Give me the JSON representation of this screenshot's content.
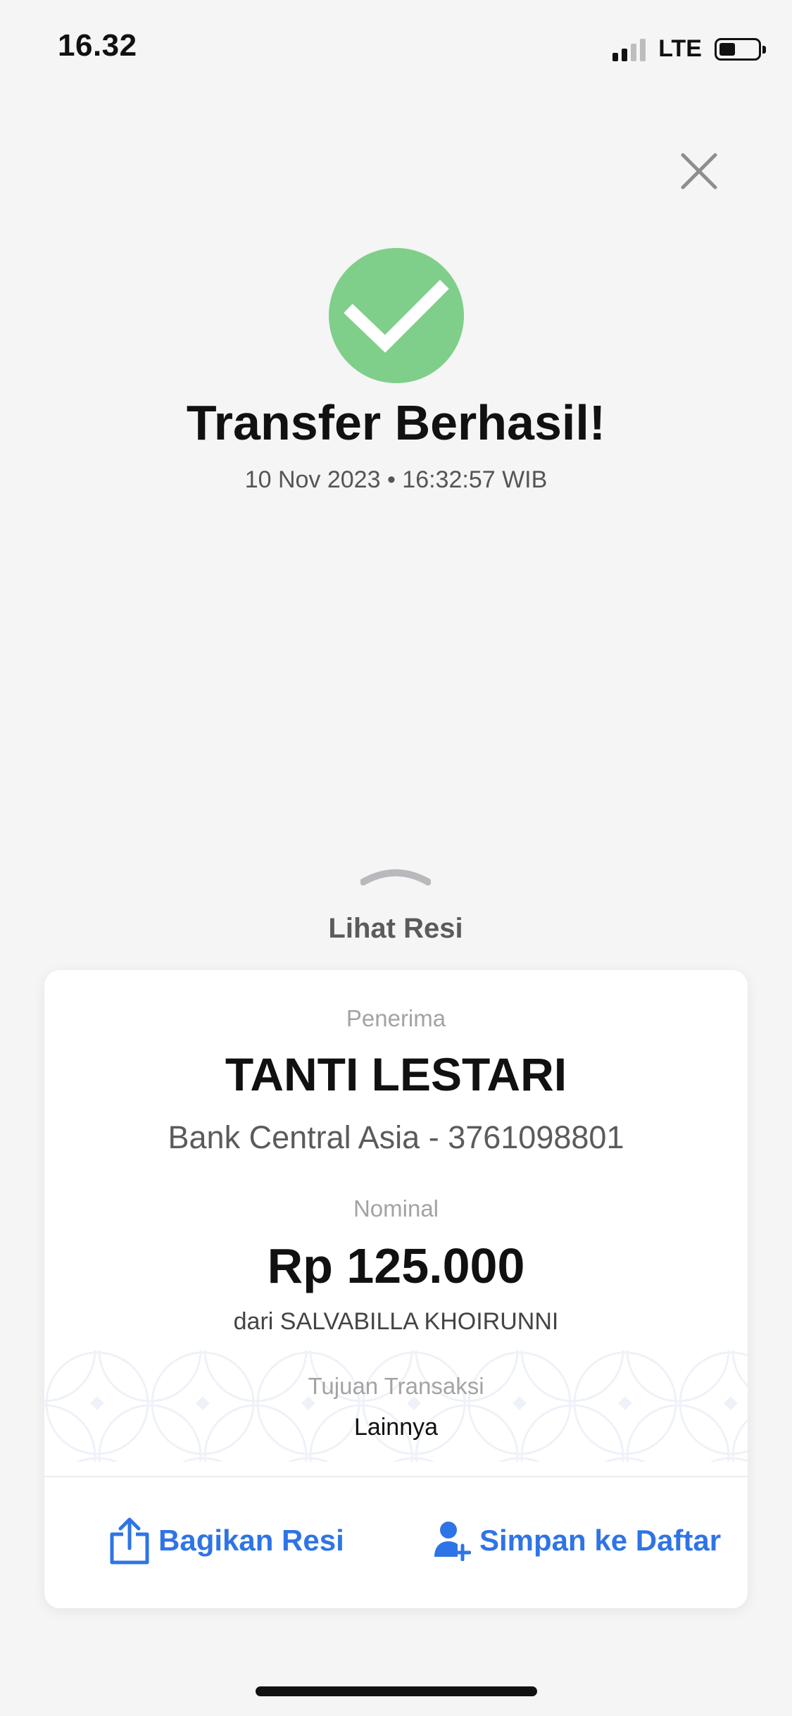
{
  "status_bar": {
    "time": "16.32",
    "network": "LTE",
    "icons": {
      "signal": "signal-icon",
      "battery": "battery-icon"
    }
  },
  "header": {
    "close_icon": "close-icon",
    "success_icon": "check-circle-icon",
    "title": "Transfer Berhasil!",
    "datetime": "10 Nov 2023 • 16:32:57 WIB"
  },
  "receipt_toggle": {
    "label": "Lihat Resi",
    "icon": "chevron-up-icon"
  },
  "receipt": {
    "recipient_label": "Penerima",
    "recipient_name": "TANTI LESTARI",
    "recipient_bank": "Bank Central Asia - 3761098801",
    "nominal_label": "Nominal",
    "nominal_value": "Rp 125.000",
    "sender": "dari SALVABILLA KHOIRUNNI",
    "purpose_label": "Tujuan Transaksi",
    "purpose_value": "Lainnya"
  },
  "actions": {
    "share_label": "Bagikan Resi",
    "share_icon": "share-icon",
    "save_label": "Simpan ke Daftar",
    "save_icon": "add-person-icon"
  },
  "colors": {
    "accent": "#2f74e6",
    "success": "#7fcf8a",
    "background": "#f5f5f5"
  }
}
